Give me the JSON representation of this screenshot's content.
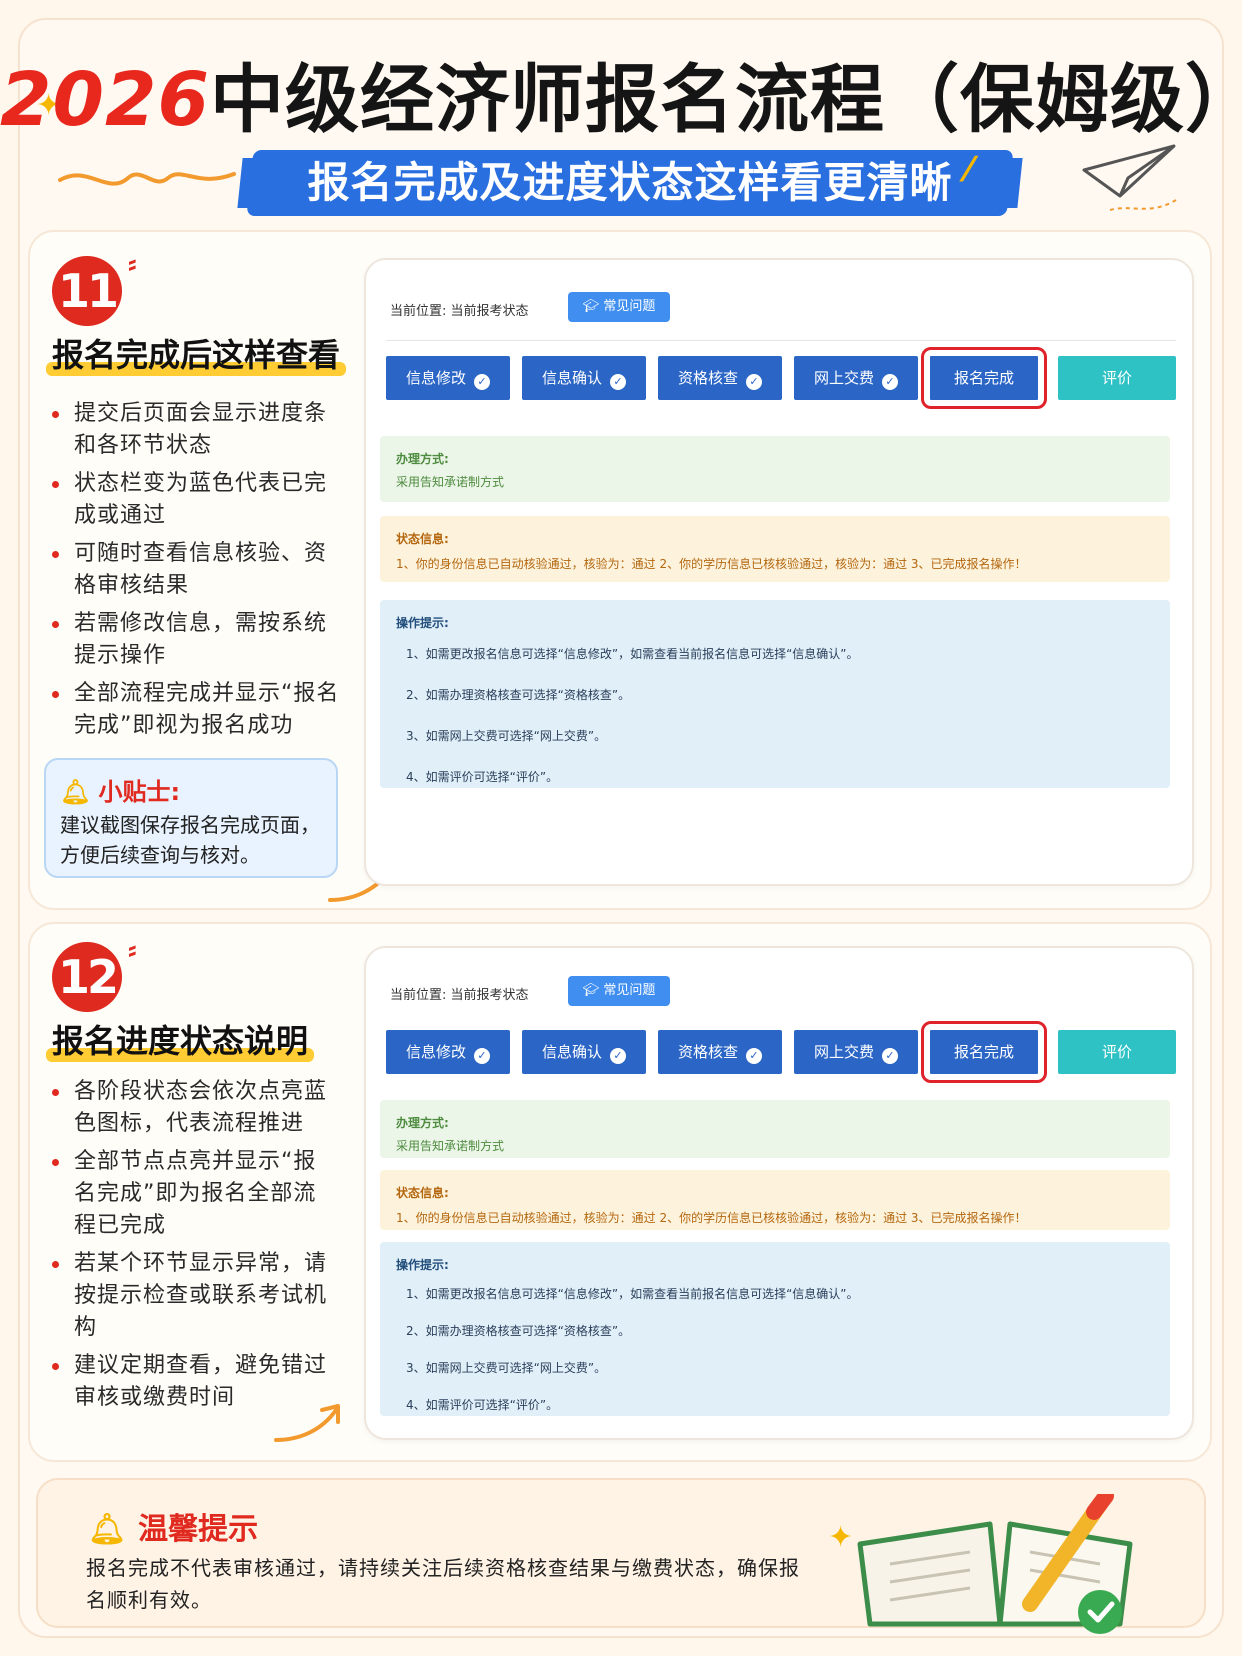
{
  "header": {
    "title_year": "2026",
    "title_rest": "中级经济师报名流程（保姆级）",
    "banner": "报名完成及进度状态这样看更清晰"
  },
  "section11": {
    "number": "11",
    "heading": "报名完成后这样查看",
    "bullets": [
      "提交后页面会显示进度条和各环节状态",
      "状态栏变为蓝色代表已完成或通过",
      "可随时查看信息核验、资格审核结果",
      "若需修改信息，需按系统提示操作",
      "全部流程完成并显示“报名完成”即视为报名成功"
    ],
    "tip_title": "小贴士:",
    "tip_body": "建议截图保存报名完成页面，方便后续查询与核对。"
  },
  "section12": {
    "number": "12",
    "heading": "报名进度状态说明",
    "bullets": [
      "各阶段状态会依次点亮蓝色图标，代表流程推进",
      "全部节点点亮并显示“报名完成”即为报名全部流程已完成",
      "若某个环节显示异常，请按提示检查或联系考试机构",
      "建议定期查看，避免错过审核或缴费时间"
    ]
  },
  "screenshot": {
    "location": "当前位置:  当前报考状态",
    "faq_button": "常见问题",
    "tabs": [
      "信息修改",
      "信息确认",
      "资格核查",
      "网上交费",
      "报名完成",
      "评价"
    ],
    "method_label": "办理方式:",
    "method_text": "采用告知承诺制方式",
    "status_label": "状态信息:",
    "status_text": "1、你的身份信息已自动核验通过，核验为：通过  2、你的学历信息已核核验通过，核验为：通过  3、已完成报名操作！",
    "ops_label": "操作提示:",
    "ops": [
      "1、如需更改报名信息可选择“信息修改”，如需查看当前报名信息可选择“信息确认”。",
      "2、如需办理资格核查可选择“资格核查”。",
      "3、如需网上交费可选择“网上交费”。",
      "4、如需评价可选择“评价”。"
    ]
  },
  "footer": {
    "title": "温馨提示",
    "body": "报名完成不代表审核通过，请持续关注后续资格核查结果与缴费状态，确保报名顺利有效。"
  },
  "colors": {
    "accent_red": "#e0291f",
    "banner_blue": "#2a6fe0",
    "tab_blue": "#2b66c7",
    "tab_teal": "#2fc2c4",
    "highlight_yellow": "#ffcc33"
  },
  "icons": [
    "sparkle-icon",
    "paper-plane-icon",
    "bell-icon",
    "check-icon",
    "graduation-cap-icon",
    "arrow-icon",
    "book-pencil-icon"
  ]
}
